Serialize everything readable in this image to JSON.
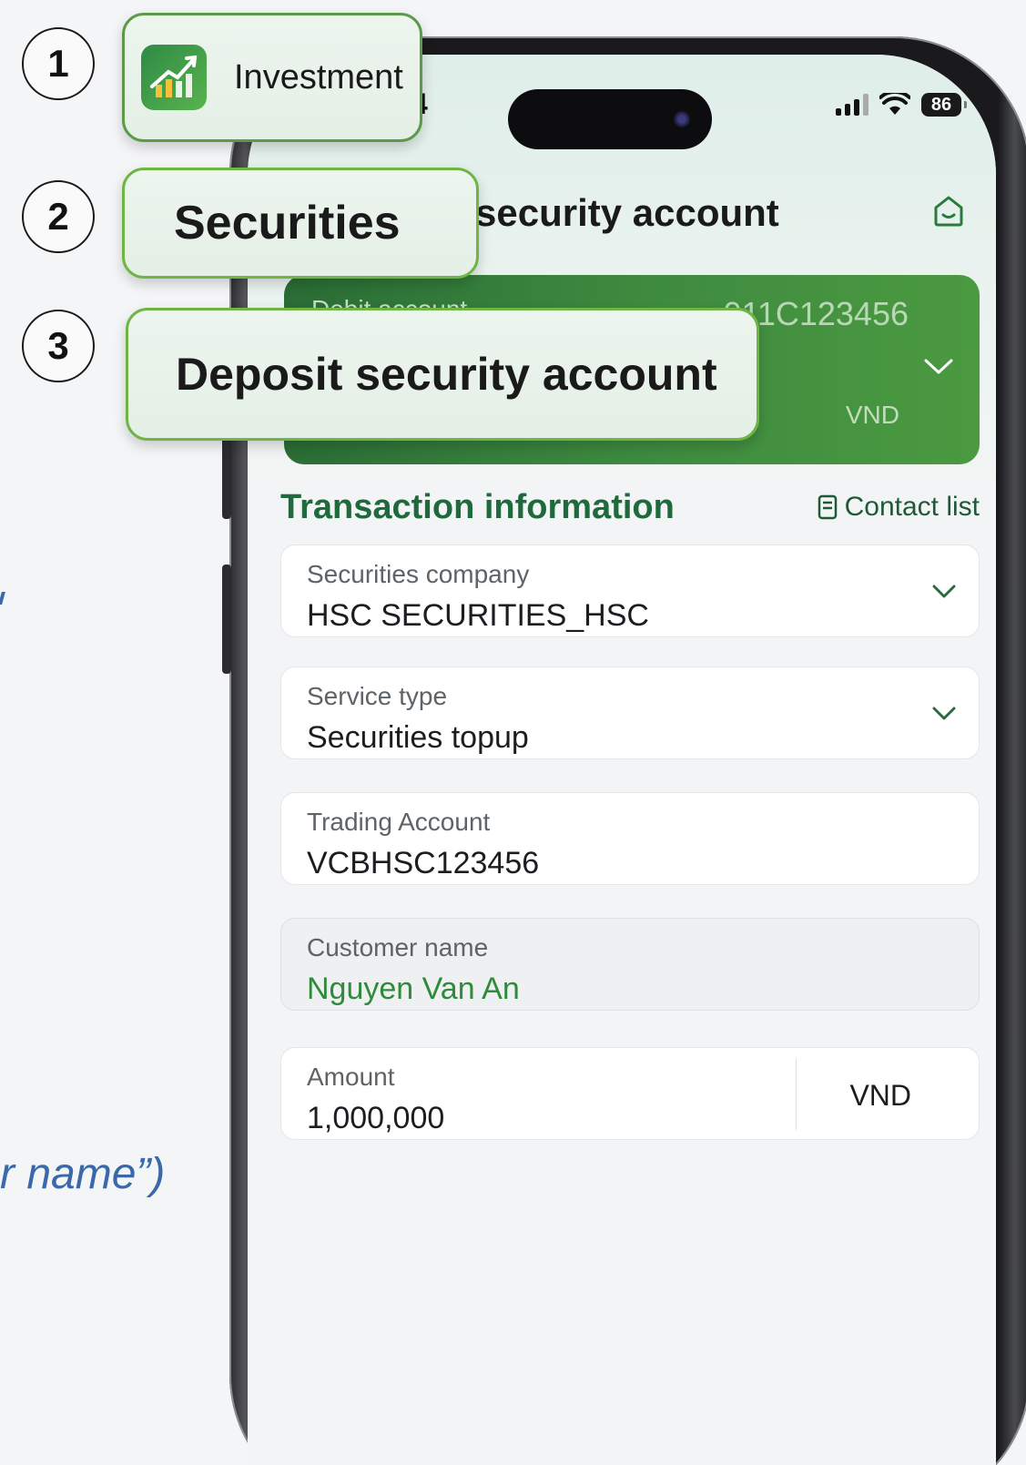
{
  "guide": {
    "side_text": "r name”)"
  },
  "breadcrumb": {
    "steps": [
      {
        "number": "1",
        "label": "Investment"
      },
      {
        "number": "2",
        "label": "Securities"
      },
      {
        "number": "3",
        "label": "Deposit security account"
      }
    ]
  },
  "status_bar": {
    "time_partial": "4",
    "battery": "86"
  },
  "header": {
    "title_partial": "security account"
  },
  "debit_card": {
    "label": "Debit account",
    "account_number_partial": "011C123456",
    "currency": "VND"
  },
  "transaction": {
    "section_title": "Transaction information",
    "contact_list_label": "Contact list",
    "fields": {
      "securities_company": {
        "label": "Securities company",
        "value": "HSC SECURITIES_HSC"
      },
      "service_type": {
        "label": "Service type",
        "value": "Securities topup"
      },
      "trading_account": {
        "label": "Trading Account",
        "value": "VCBHSC123456"
      },
      "customer_name": {
        "label": "Customer name",
        "value": "Nguyen Van An"
      },
      "amount": {
        "label": "Amount",
        "value": "1,000,000",
        "currency": "VND"
      }
    }
  },
  "colors": {
    "brand_green": "#1f6a3c",
    "card_green": "#3d8a3f",
    "callout_border": "#6eb544",
    "value_green": "#2e8b3c",
    "guide_blue": "#3a68a8"
  },
  "icons": [
    "investment-app-icon",
    "home-icon",
    "book-icon",
    "chevron-down-icon",
    "wifi-icon",
    "signal-icon",
    "battery-icon"
  ]
}
